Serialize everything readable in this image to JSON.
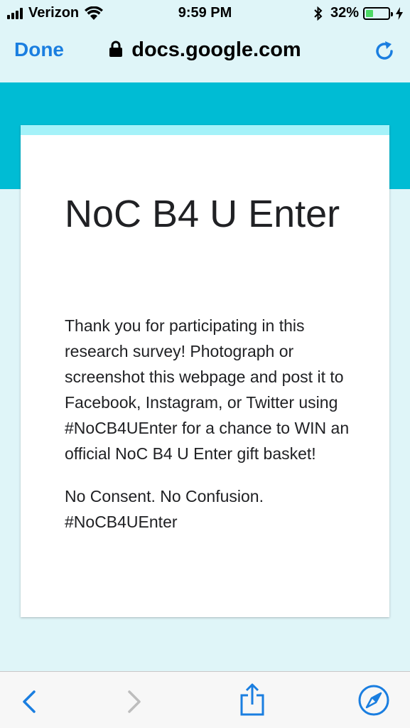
{
  "status_bar": {
    "carrier": "Verizon",
    "time": "9:59 PM",
    "battery_percent": "32%",
    "battery_level": 0.32,
    "icons": [
      "signal-icon",
      "wifi-icon",
      "bluetooth-icon",
      "battery-icon",
      "charging-icon"
    ]
  },
  "nav": {
    "done_label": "Done",
    "url": "docs.google.com",
    "icons": [
      "lock-icon",
      "reload-icon"
    ]
  },
  "colors": {
    "accent": "#1a7ee0",
    "banner": "#00bcd4",
    "card_top": "#a4f2f9",
    "page_bg": "#dff5f8"
  },
  "form": {
    "title": "NoC B4 U Enter",
    "paragraphs": [
      "Thank you for participating in this research survey! Photograph or screenshot this webpage and post it to Facebook, Instagram, or Twitter using #NoCB4UEnter for a chance to WIN an official NoC B4 U Enter gift basket!",
      "No Consent. No Confusion. #NoCB4UEnter"
    ]
  },
  "toolbar": {
    "icons": [
      "back-icon",
      "forward-icon",
      "share-icon",
      "compass-icon"
    ]
  }
}
